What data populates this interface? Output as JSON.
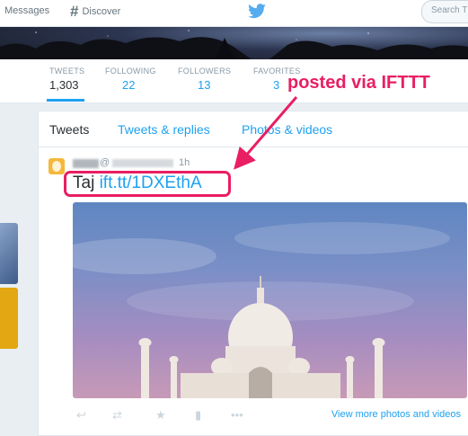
{
  "topbar": {
    "messages_label": "Messages",
    "discover_label": "Discover",
    "search_placeholder": "Search T"
  },
  "profile_nav": {
    "stats": [
      {
        "label": "TWEETS",
        "value": "1,303"
      },
      {
        "label": "FOLLOWING",
        "value": "22"
      },
      {
        "label": "FOLLOWERS",
        "value": "13"
      },
      {
        "label": "FAVORITES",
        "value": "3"
      }
    ]
  },
  "timeline": {
    "tabs": [
      "Tweets",
      "Tweets & replies",
      "Photos & videos"
    ],
    "tweet": {
      "handle_prefix": "@",
      "time": "1h",
      "text": "Taj",
      "link": "ift.tt/1DXEthA",
      "view_more": "View more photos and videos"
    }
  },
  "annotation": {
    "text": "posted via IFTTT",
    "color": "#e91e63"
  },
  "colors": {
    "accent": "#1da1f2",
    "highlight": "#e91e63"
  },
  "icons": [
    "messages-icon",
    "hashtag-icon",
    "twitter-bird-icon",
    "reply-icon",
    "retweet-icon",
    "favorite-icon",
    "analytics-icon",
    "more-icon"
  ]
}
